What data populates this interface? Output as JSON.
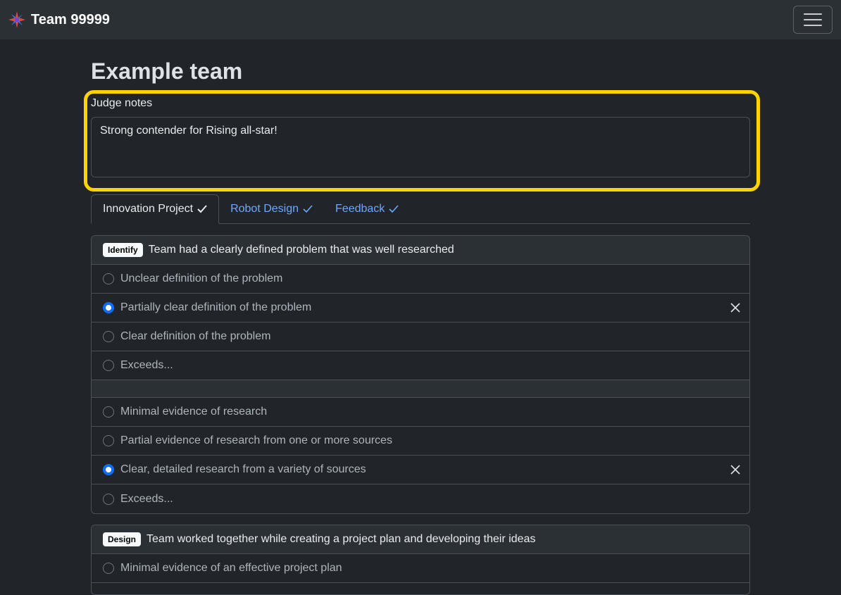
{
  "navbar": {
    "brand": "Team 99999"
  },
  "page": {
    "title": "Example team"
  },
  "notes": {
    "label": "Judge notes",
    "value": "Strong contender for Rising all-star!"
  },
  "tabs": [
    {
      "label": "Innovation Project",
      "active": true
    },
    {
      "label": "Robot Design",
      "active": false
    },
    {
      "label": "Feedback",
      "active": false
    }
  ],
  "sections": [
    {
      "badge": "Identify",
      "title": "Team had a clearly defined problem that was well researched",
      "groups": [
        [
          "Unclear definition of the problem",
          "Partially clear definition of the problem",
          "Clear definition of the problem",
          "Exceeds..."
        ],
        [
          "Minimal evidence of research",
          "Partial evidence of research from one or more sources",
          "Clear, detailed research from a variety of sources",
          "Exceeds..."
        ]
      ]
    },
    {
      "badge": "Design",
      "title": "Team worked together while creating a project plan and developing their ideas",
      "groups": [
        [
          "Minimal evidence of an effective project plan"
        ]
      ]
    }
  ],
  "colors": {
    "accent": "#0d6efd",
    "highlight": "#ffd200",
    "link": "#6ea8fe"
  }
}
